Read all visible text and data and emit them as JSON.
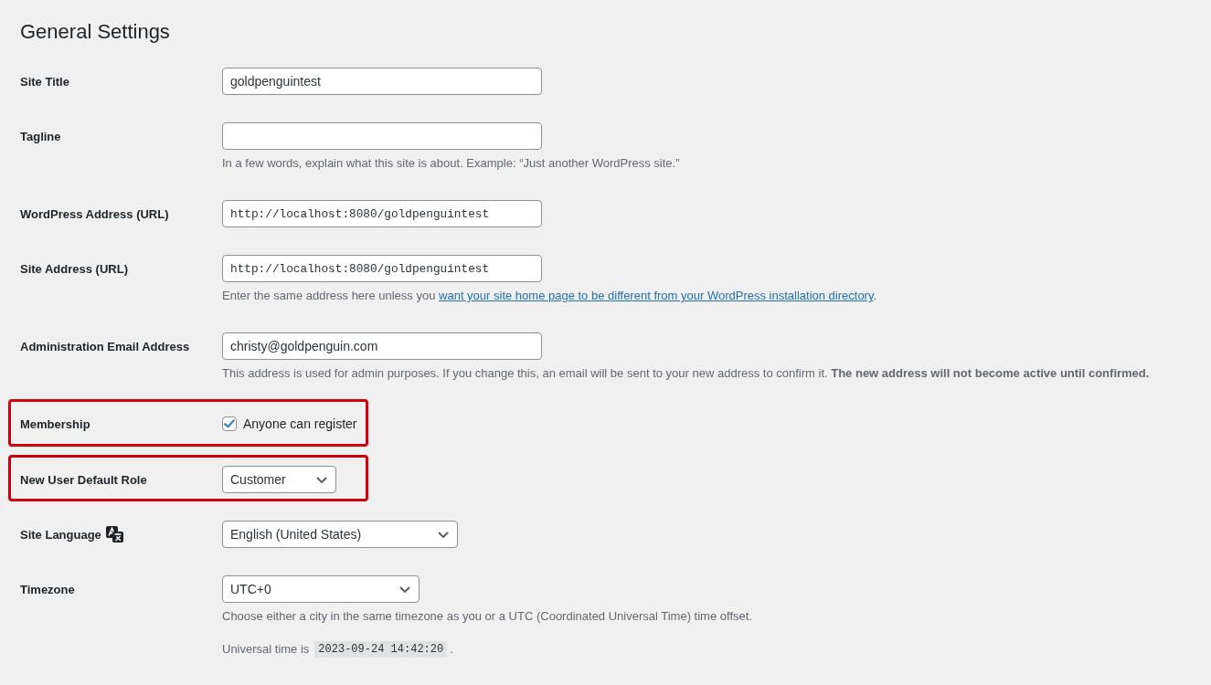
{
  "page": {
    "title": "General Settings"
  },
  "settings": [
    {
      "kind": "text",
      "label": "Site Title",
      "value": "goldpenguintest",
      "highlighted": false
    },
    {
      "kind": "text",
      "label": "Tagline",
      "highlighted": false,
      "description": [
        {
          "kind": "text",
          "text": "In a few words, explain what this site is about. Example: “Just another WordPress site.”"
        }
      ]
    },
    {
      "kind": "url",
      "label": "WordPress Address (URL)",
      "value": "http://localhost:8080/goldpenguintest",
      "highlighted": false
    },
    {
      "kind": "url",
      "label": "Site Address (URL)",
      "value": "http://localhost:8080/goldpenguintest",
      "highlighted": false,
      "description": [
        {
          "kind": "text",
          "text": "Enter the same address here unless you "
        },
        {
          "kind": "link",
          "text": "want your site home page to be different from your WordPress installation directory"
        },
        {
          "kind": "text",
          "text": "."
        }
      ]
    },
    {
      "kind": "text",
      "label": "Administration Email Address",
      "value": "christy@goldpenguin.com",
      "highlighted": false,
      "description": [
        {
          "kind": "text",
          "text": "This address is used for admin purposes. If you change this, an email will be sent to your new address to confirm it. **The new address will not become active until confirmed.**"
        }
      ]
    },
    {
      "kind": "checkbox",
      "label": "Membership",
      "option": "Anyone can register",
      "checked": true,
      "highlighted": true
    },
    {
      "kind": "select",
      "label": "New User Default Role",
      "value": "Customer",
      "highlighted": true
    },
    {
      "kind": "select",
      "label": "Site Language",
      "label_icon": true,
      "value": "English (United States)",
      "highlighted": false
    },
    {
      "kind": "select",
      "label": "Timezone",
      "value": "UTC+0",
      "highlighted": false,
      "description": [
        {
          "kind": "text",
          "text": "Choose either a city in the same timezone as you or a UTC (Coordinated Universal Time) time offset."
        }
      ],
      "note": {
        "label": "Universal time is",
        "value": "2023-09-24 14:42:20",
        "suffix": "."
      }
    }
  ]
}
